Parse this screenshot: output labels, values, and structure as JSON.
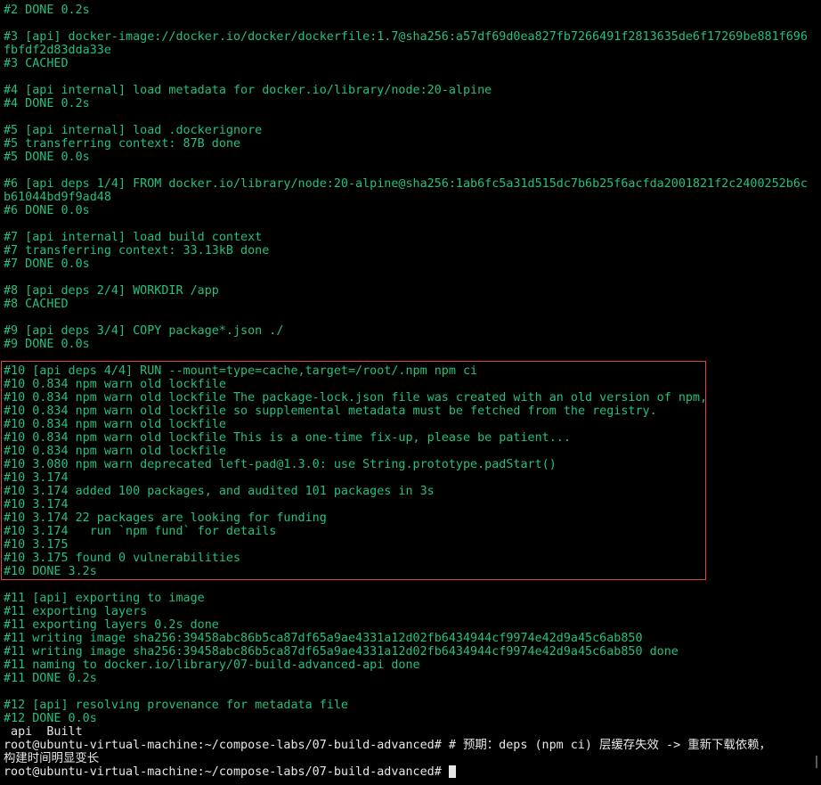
{
  "terminal": {
    "colors": {
      "background": "#000000",
      "output_text": "#23c07e",
      "prompt_text": "#e6e6e6",
      "highlight_border": "#e0453a"
    },
    "lines": [
      "#2 DONE 0.2s",
      "",
      "#3 [api] docker-image://docker.io/docker/dockerfile:1.7@sha256:a57df69d0ea827fb7266491f2813635de6f17269be881f696",
      "fbfdf2d83dda33e",
      "#3 CACHED",
      "",
      "#4 [api internal] load metadata for docker.io/library/node:20-alpine",
      "#4 DONE 0.2s",
      "",
      "#5 [api internal] load .dockerignore",
      "#5 transferring context: 87B done",
      "#5 DONE 0.0s",
      "",
      "#6 [api deps 1/4] FROM docker.io/library/node:20-alpine@sha256:1ab6fc5a31d515dc7b6b25f6acfda2001821f2c2400252b6c",
      "b61044bd9f9ad48",
      "#6 DONE 0.0s",
      "",
      "#7 [api internal] load build context",
      "#7 transferring context: 33.13kB done",
      "#7 DONE 0.0s",
      "",
      "#8 [api deps 2/4] WORKDIR /app",
      "#8 CACHED",
      "",
      "#9 [api deps 3/4] COPY package*.json ./",
      "#9 DONE 0.0s",
      "",
      "#10 [api deps 4/4] RUN --mount=type=cache,target=/root/.npm npm ci",
      "#10 0.834 npm warn old lockfile",
      "#10 0.834 npm warn old lockfile The package-lock.json file was created with an old version of npm,",
      "#10 0.834 npm warn old lockfile so supplemental metadata must be fetched from the registry.",
      "#10 0.834 npm warn old lockfile",
      "#10 0.834 npm warn old lockfile This is a one-time fix-up, please be patient...",
      "#10 0.834 npm warn old lockfile",
      "#10 3.080 npm warn deprecated left-pad@1.3.0: use String.prototype.padStart()",
      "#10 3.174",
      "#10 3.174 added 100 packages, and audited 101 packages in 3s",
      "#10 3.174",
      "#10 3.174 22 packages are looking for funding",
      "#10 3.174   run `npm fund` for details",
      "#10 3.175",
      "#10 3.175 found 0 vulnerabilities",
      "#10 DONE 3.2s",
      "",
      "#11 [api] exporting to image",
      "#11 exporting layers",
      "#11 exporting layers 0.2s done",
      "#11 writing image sha256:39458abc86b5ca87df65a9ae4331a12d02fb6434944cf9974e42d9a45c6ab850",
      "#11 writing image sha256:39458abc86b5ca87df65a9ae4331a12d02fb6434944cf9974e42d9a45c6ab850 done",
      "#11 naming to docker.io/library/07-build-advanced-api done",
      "#11 DONE 0.2s",
      "",
      "#12 [api] resolving provenance for metadata file",
      "#12 DONE 0.0s"
    ],
    "built_status": " api  Built",
    "prompt_line_1": "root@ubuntu-virtual-machine:~/compose-labs/07-build-advanced# # 预期：deps (npm ci) 层缓存失效 -> 重新下载依赖，",
    "prompt_line_2": "构建时间明显变长",
    "prompt_line_3": "root@ubuntu-virtual-machine:~/compose-labs/07-build-advanced# "
  }
}
